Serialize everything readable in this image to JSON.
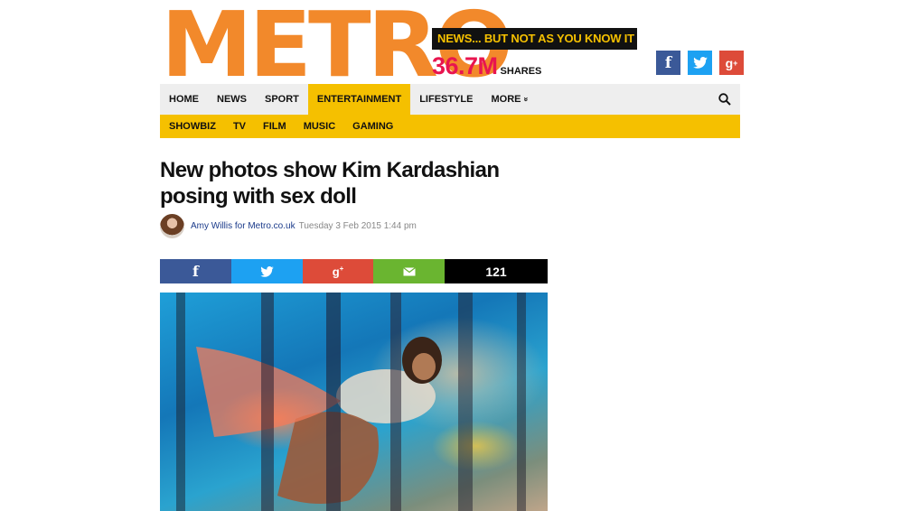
{
  "masthead": {
    "logo": "METRO",
    "tagline": "NEWS... BUT NOT AS YOU KNOW IT",
    "shares_count": "36.7M",
    "shares_label": "SHARES",
    "social_icons": [
      "facebook-icon",
      "twitter-icon",
      "google-plus-icon"
    ]
  },
  "nav": {
    "main": [
      {
        "label": "HOME"
      },
      {
        "label": "NEWS"
      },
      {
        "label": "SPORT"
      },
      {
        "label": "ENTERTAINMENT"
      },
      {
        "label": "LIFESTYLE"
      },
      {
        "label": "MORE"
      }
    ],
    "active": "ENTERTAINMENT",
    "more_chevron": "»",
    "search_icon": "search-icon",
    "sub": [
      {
        "label": "SHOWBIZ"
      },
      {
        "label": "TV"
      },
      {
        "label": "FILM"
      },
      {
        "label": "MUSIC"
      },
      {
        "label": "GAMING"
      }
    ]
  },
  "article": {
    "headline": "New photos show Kim Kardashian posing with sex doll",
    "author": "Amy Willis for Metro.co.uk",
    "date": "Tuesday 3 Feb 2015 1:44 pm",
    "share_count": "121",
    "share_icons": [
      "facebook-icon",
      "twitter-icon",
      "google-plus-icon",
      "email-icon"
    ]
  },
  "colors": {
    "brand_orange": "#f2892b",
    "accent_yellow": "#f5c000",
    "shares_pink": "#e8154f",
    "facebook": "#3b5998",
    "twitter": "#1da1f2",
    "google_plus": "#dd4b39",
    "email": "#6ab530"
  }
}
